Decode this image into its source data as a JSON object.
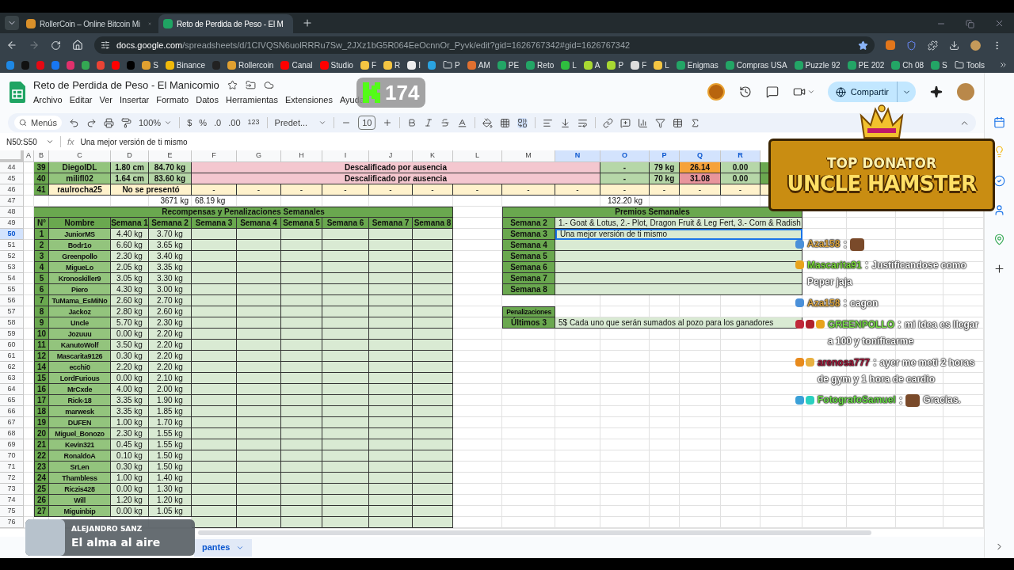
{
  "browser": {
    "tabs": [
      {
        "title": "RollerCoin – Online Bitcoin Mi",
        "selected": false
      },
      {
        "title": "Reto de Perdida de Peso - El M",
        "selected": true
      }
    ],
    "url_host": "docs.google.com",
    "url_path": "/spreadsheets/d/1CIVQSN6uolRRRu7Sw_2JXz1bG5R064EeOcnnOr_Pyvk/edit?gid=1626767342#gid=1626767342",
    "bookmarks": [
      {
        "kind": "site",
        "color": "#1e88e5"
      },
      {
        "kind": "site",
        "color": "#111111"
      },
      {
        "kind": "site",
        "color": "#e50914"
      },
      {
        "kind": "site",
        "color": "#1877f2"
      },
      {
        "kind": "site",
        "color": "#e1306c"
      },
      {
        "kind": "site",
        "color": "#34a853"
      },
      {
        "kind": "site",
        "color": "#ea4335"
      },
      {
        "kind": "site",
        "color": "#ff0000"
      },
      {
        "kind": "site",
        "color": "#000000"
      },
      {
        "kind": "site",
        "label": "S",
        "color": "#e0a030"
      },
      {
        "kind": "site",
        "label": "Binance",
        "color": "#f0b90b"
      },
      {
        "kind": "site",
        "color": "#222222"
      },
      {
        "kind": "site",
        "label": "Rollercoin",
        "color": "#e0a030"
      },
      {
        "kind": "site",
        "label": "Canal",
        "color": "#ff0000"
      },
      {
        "kind": "site",
        "label": "Studio",
        "color": "#ff0000"
      },
      {
        "kind": "site",
        "label": "F",
        "color": "#f4c542"
      },
      {
        "kind": "site",
        "label": "R",
        "color": "#f4c542"
      },
      {
        "kind": "site",
        "label": "I",
        "color": "#eeeeee"
      },
      {
        "kind": "site",
        "color": "#2aa3e0"
      },
      {
        "kind": "folder",
        "label": "P"
      },
      {
        "kind": "site",
        "label": "AM",
        "color": "#e07030"
      },
      {
        "kind": "site",
        "label": "PE",
        "color": "#23a566"
      },
      {
        "kind": "site",
        "label": "Reto",
        "color": "#23a566"
      },
      {
        "kind": "site",
        "label": "L",
        "color": "#2fbf3f"
      },
      {
        "kind": "site",
        "label": "A",
        "color": "#a8d832"
      },
      {
        "kind": "site",
        "label": "P",
        "color": "#a8d832"
      },
      {
        "kind": "site",
        "label": "F",
        "color": "#dddddd"
      },
      {
        "kind": "site",
        "label": "L",
        "color": "#f4c542"
      },
      {
        "kind": "site",
        "label": "Enigmas",
        "color": "#23a566"
      },
      {
        "kind": "site",
        "label": "Compras USA",
        "color": "#23a566"
      },
      {
        "kind": "site",
        "label": "Puzzle 92",
        "color": "#23a566"
      },
      {
        "kind": "site",
        "label": "PE 202",
        "color": "#23a566"
      },
      {
        "kind": "site",
        "label": "Ch 08",
        "color": "#23a566"
      },
      {
        "kind": "site",
        "label": "S",
        "color": "#23a566"
      },
      {
        "kind": "folder",
        "label": "Tools"
      }
    ]
  },
  "doc": {
    "title": "Reto de Perdida de Peso - El Manicomio",
    "menu": [
      "Archivo",
      "Editar",
      "Ver",
      "Insertar",
      "Formato",
      "Datos",
      "Herramientas",
      "Extensiones",
      "Ayuda"
    ],
    "share": "Compartir"
  },
  "toolbar": {
    "search": "Menús",
    "zoom": "100%",
    "currency": "$",
    "percent": "%",
    "decrease_decimals": ".0",
    "increase_decimals": ".00",
    "number_format": "123",
    "font": "Predet...",
    "font_size": "10"
  },
  "formula_bar": {
    "range": "N50:S50",
    "fx": "fx",
    "value": "Una mejor versión de ti mismo"
  },
  "sheet": {
    "columns": [
      {
        "label": "A",
        "selected": false
      },
      {
        "label": "B",
        "selected": false
      },
      {
        "label": "C",
        "selected": false
      },
      {
        "label": "D",
        "selected": false
      },
      {
        "label": "E",
        "selected": false
      },
      {
        "label": "F",
        "selected": false
      },
      {
        "label": "G",
        "selected": false
      },
      {
        "label": "H",
        "selected": false
      },
      {
        "label": "I",
        "selected": false
      },
      {
        "label": "J",
        "selected": false
      },
      {
        "label": "K",
        "selected": false
      },
      {
        "label": "L",
        "selected": false
      },
      {
        "label": "M",
        "selected": false
      },
      {
        "label": "N",
        "selected": true
      },
      {
        "label": "O",
        "selected": true
      },
      {
        "label": "P",
        "selected": true
      },
      {
        "label": "Q",
        "selected": true
      },
      {
        "label": "R",
        "selected": true
      }
    ],
    "rows": [
      {
        "label": "44",
        "selected": false
      },
      {
        "label": "45",
        "selected": false
      },
      {
        "label": "46",
        "selected": false
      },
      {
        "label": "47",
        "selected": false
      },
      {
        "label": "48",
        "selected": false
      },
      {
        "label": "49",
        "selected": false
      },
      {
        "label": "50",
        "selected": true
      },
      {
        "label": "51",
        "selected": false
      },
      {
        "label": "52",
        "selected": false
      },
      {
        "label": "53",
        "selected": false
      },
      {
        "label": "54",
        "selected": false
      },
      {
        "label": "55",
        "selected": false
      },
      {
        "label": "56",
        "selected": false
      },
      {
        "label": "57",
        "selected": false
      },
      {
        "label": "58",
        "selected": false
      },
      {
        "label": "59",
        "selected": false
      },
      {
        "label": "60",
        "selected": false
      },
      {
        "label": "61",
        "selected": false
      },
      {
        "label": "62",
        "selected": false
      },
      {
        "label": "63",
        "selected": false
      },
      {
        "label": "64",
        "selected": false
      },
      {
        "label": "65",
        "selected": false
      },
      {
        "label": "66",
        "selected": false
      },
      {
        "label": "67",
        "selected": false
      },
      {
        "label": "68",
        "selected": false
      },
      {
        "label": "69",
        "selected": false
      },
      {
        "label": "70",
        "selected": false
      },
      {
        "label": "71",
        "selected": false
      },
      {
        "label": "72",
        "selected": false
      },
      {
        "label": "73",
        "selected": false
      },
      {
        "label": "74",
        "selected": false
      },
      {
        "label": "75",
        "selected": false
      },
      {
        "label": "76",
        "selected": false
      }
    ],
    "top_rows": [
      {
        "kind": "disqualified",
        "number": "39",
        "name": "DiegoIDL",
        "height": "1.80 cm",
        "weight": "84.70 kg",
        "status": "Descalificado por ausencia",
        "column_o": "-",
        "column_p": "79 kg",
        "column_q": "26.14",
        "color": "#f6a23a",
        "column_r": "0.00"
      },
      {
        "kind": "disqualified",
        "number": "40",
        "name": "milifl02",
        "height": "1.64 cm",
        "weight": "83.60 kg",
        "status": "Descalificado por ausencia",
        "column_o": "-",
        "column_p": "70 kg",
        "column_q": "31.08",
        "color": "#e8959c",
        "column_r": "0.00"
      },
      {
        "kind": "absent",
        "number": "41",
        "name": "raulrocha25",
        "status": "No se presentó",
        "dashes": [
          "-",
          "-",
          "-",
          "-",
          "-",
          "-",
          "-",
          "-",
          "-",
          "-",
          "-",
          "-",
          "-"
        ]
      }
    ],
    "totals": {
      "column_e": "3671 kg",
      "column_f": "68.19 kg",
      "column_o": "132.20 kg"
    },
    "rewards": {
      "title": "Recompensas y Penalizaciones Semanales",
      "headers": [
        "N°",
        "Nombre",
        "Semana 1",
        "Semana 2",
        "Semana 3",
        "Semana 4",
        "Semana 5",
        "Semana 6",
        "Semana 7",
        "Semana 8"
      ],
      "participants": [
        {
          "number": "1",
          "name": "JuniorMS",
          "week_1": "4.40 kg",
          "week_2": "3.70 kg"
        },
        {
          "number": "2",
          "name": "Bodr1o",
          "week_1": "6.60 kg",
          "week_2": "3.65 kg"
        },
        {
          "number": "3",
          "name": "Greenpollo",
          "week_1": "2.30 kg",
          "week_2": "3.40 kg"
        },
        {
          "number": "4",
          "name": "MigueLo",
          "week_1": "2.05 kg",
          "week_2": "3.35 kg"
        },
        {
          "number": "5",
          "name": "Kronoskiller9",
          "week_1": "3.05 kg",
          "week_2": "3.30 kg"
        },
        {
          "number": "6",
          "name": "Piero",
          "week_1": "4.30 kg",
          "week_2": "3.00 kg"
        },
        {
          "number": "7",
          "name": "TuMama_EsMiNo",
          "week_1": "2.60 kg",
          "week_2": "2.70 kg"
        },
        {
          "number": "8",
          "name": "Jackoz",
          "week_1": "2.80 kg",
          "week_2": "2.60 kg"
        },
        {
          "number": "9",
          "name": "Uncle",
          "week_1": "5.70 kg",
          "week_2": "2.30 kg"
        },
        {
          "number": "10",
          "name": "Jozuuu",
          "week_1": "0.00 kg",
          "week_2": "2.20 kg"
        },
        {
          "number": "11",
          "name": "KanutoWolf",
          "week_1": "3.50 kg",
          "week_2": "2.20 kg"
        },
        {
          "number": "12",
          "name": "Mascarita9126",
          "week_1": "0.30 kg",
          "week_2": "2.20 kg"
        },
        {
          "number": "14",
          "name": "ecchi0",
          "week_1": "2.20 kg",
          "week_2": "2.20 kg"
        },
        {
          "number": "15",
          "name": "LordFurious",
          "week_1": "0.00 kg",
          "week_2": "2.10 kg"
        },
        {
          "number": "16",
          "name": "MrCxde",
          "week_1": "4.00 kg",
          "week_2": "2.00 kg"
        },
        {
          "number": "17",
          "name": "Rick-18",
          "week_1": "3.35 kg",
          "week_2": "1.90 kg"
        },
        {
          "number": "18",
          "name": "marwesk",
          "week_1": "3.35 kg",
          "week_2": "1.85 kg"
        },
        {
          "number": "19",
          "name": "DUFEN",
          "week_1": "1.00 kg",
          "week_2": "1.70 kg"
        },
        {
          "number": "20",
          "name": "Miguel_Bonozo",
          "week_1": "2.30 kg",
          "week_2": "1.55 kg"
        },
        {
          "number": "21",
          "name": "Kevin321",
          "week_1": "0.45 kg",
          "week_2": "1.55 kg"
        },
        {
          "number": "22",
          "name": "RonaldoA",
          "week_1": "0.10 kg",
          "week_2": "1.50 kg"
        },
        {
          "number": "23",
          "name": "SrLen",
          "week_1": "0.30 kg",
          "week_2": "1.50 kg"
        },
        {
          "number": "24",
          "name": "Thambless",
          "week_1": "1.00 kg",
          "week_2": "1.40 kg"
        },
        {
          "number": "25",
          "name": "Riczis428",
          "week_1": "0.00 kg",
          "week_2": "1.30 kg"
        },
        {
          "number": "26",
          "name": "Will",
          "week_1": "1.20 kg",
          "week_2": "1.20 kg"
        },
        {
          "number": "27",
          "name": "Miguinbip",
          "week_1": "0.00 kg",
          "week_2": "1.05 kg"
        }
      ]
    },
    "prizes": {
      "title": "Premios Semanales",
      "rows": [
        {
          "label": "Semana 2",
          "value": "1.- Goat & Lotus, 2.- Plot, Dragon Fruit & Leg Fert, 3.- Corn & Radish",
          "selected": false
        },
        {
          "label": "Semana 3",
          "value": "Una mejor versión de ti mismo",
          "selected": true
        },
        {
          "label": "Semana 4",
          "selected": false
        },
        {
          "label": "Semana 5",
          "selected": false
        },
        {
          "label": "Semana 6",
          "selected": false
        },
        {
          "label": "Semana 7",
          "selected": false
        },
        {
          "label": "Semana 8",
          "selected": false
        }
      ]
    },
    "penalties": {
      "title": "Penalizaciones",
      "rows": [
        {
          "label": "Últimos 3",
          "value": "5$ Cada uno que serán sumados al pozo para los ganadores"
        }
      ]
    },
    "sheet_tab": {
      "label": "pantes",
      "selected": true
    }
  },
  "overlays": {
    "viewer_count": "174",
    "top_donator": {
      "title": "TOP DONATOR",
      "name": "UNCLE HAMSTER"
    },
    "chat": [
      {
        "badges": [
          {
            "color": "#4a90d9"
          }
        ],
        "user": "Aza158",
        "color": "#d9a441",
        "separator": ":",
        "emote": true
      },
      {
        "badges": [
          {
            "color": "#e8a31c"
          }
        ],
        "user": "Mascarita91",
        "color": "#7cdc3c",
        "separator": ":",
        "emote": false,
        "text": "Justificandose como Peper jaja"
      },
      {
        "badges": [
          {
            "color": "#4a90d9"
          }
        ],
        "user": "Aza158",
        "color": "#d9a441",
        "separator": ":",
        "emote": false,
        "text": "cagon"
      },
      {
        "badges": [
          {
            "color": "#c0283a"
          },
          {
            "color": "#b0202c"
          },
          {
            "color": "#e8a31c"
          }
        ],
        "user": "GREENPOLLO",
        "color": "#7ce04c",
        "separator": ":",
        "emote": false,
        "text": "mi idea es llegar a 100 y tonificarme"
      },
      {
        "badges": [
          {
            "color": "#e88a1c"
          },
          {
            "color": "#e8b040"
          }
        ],
        "user": "arenosa777",
        "color": "#a3183a",
        "separator": ":",
        "emote": false,
        "text": "ayer me meti 2 horas de gym y 1 hora de cardio"
      },
      {
        "badges": [
          {
            "color": "#3aa0d8"
          },
          {
            "color": "#2ad0c0"
          }
        ],
        "user": "FotografoSamuel",
        "color": "#6ee04c",
        "separator": ":",
        "emote": true,
        "text": "Gracias."
      }
    ],
    "now_playing": {
      "artist": "ALEJANDRO SANZ",
      "song": "El alma al aire"
    }
  }
}
